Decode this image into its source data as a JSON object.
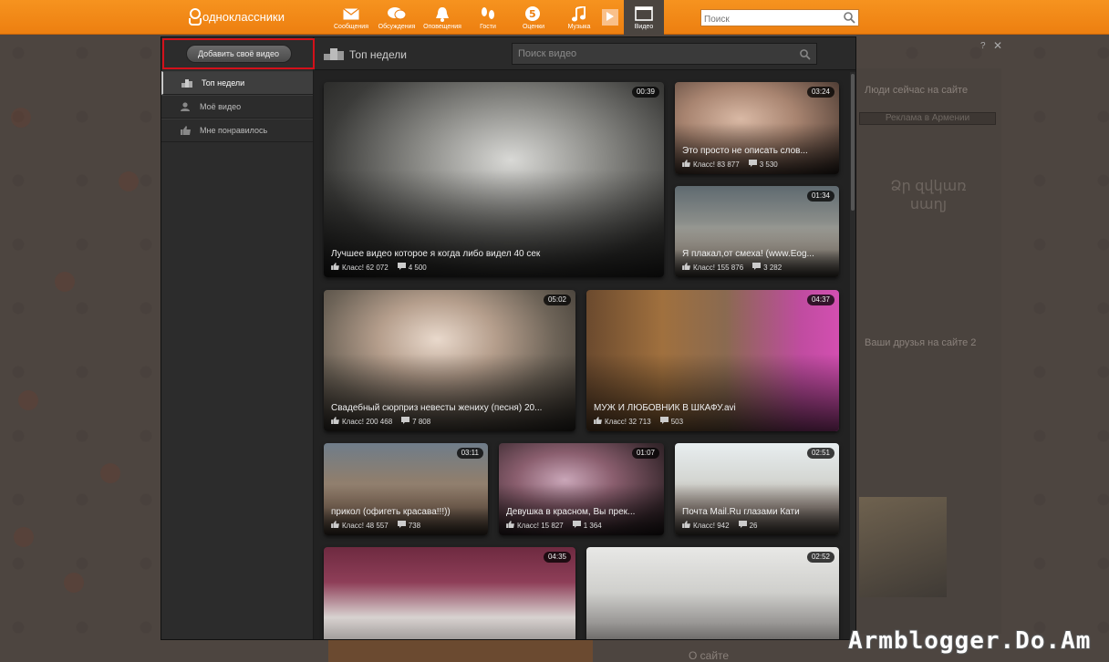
{
  "topbar": {
    "brand": "одноклассники",
    "nav": [
      {
        "label": "Сообщения",
        "icon": "envelope-icon"
      },
      {
        "label": "Обсуждения",
        "icon": "chat-bubbles-icon"
      },
      {
        "label": "Оповещения",
        "icon": "bell-icon"
      },
      {
        "label": "Гости",
        "icon": "footprints-icon"
      },
      {
        "label": "Оценки",
        "icon": "rating-5-icon"
      },
      {
        "label": "Музыка",
        "icon": "music-note-icon"
      },
      {
        "label": "Видео",
        "icon": "video-icon"
      }
    ],
    "search_placeholder": "Поиск"
  },
  "video": {
    "add_button": "Добавить своё видео",
    "menu": [
      {
        "label": "Топ недели",
        "icon": "podium-icon"
      },
      {
        "label": "Моё видео",
        "icon": "user-icon"
      },
      {
        "label": "Мне понравилось",
        "icon": "thumbs-up-icon"
      }
    ],
    "header_title": "Топ недели",
    "search_placeholder": "Поиск видео",
    "help": "?",
    "close": "✕",
    "cards": [
      {
        "title": "Лучшее видео которое я когда либо видел 40 сек",
        "duration": "00:39",
        "likes": "Класс! 62 072",
        "comments": "4 500"
      },
      {
        "title": "Это просто не описать слов...",
        "duration": "03:24",
        "likes": "Класс! 83 877",
        "comments": "3 530"
      },
      {
        "title": "Я плакал,от смеха! (www.Eog...",
        "duration": "01:34",
        "likes": "Класс! 155 876",
        "comments": "3 282"
      },
      {
        "title": "Свадебный сюрприз невесты жениху (песня) 20...",
        "duration": "05:02",
        "likes": "Класс! 200 468",
        "comments": "7 808"
      },
      {
        "title": "МУЖ И ЛЮБОВНИК В ШКАФУ.avi",
        "duration": "04:37",
        "likes": "Класс! 32 713",
        "comments": "503"
      },
      {
        "title": "прикол (офигеть красава!!!))",
        "duration": "03:11",
        "likes": "Класс! 48 557",
        "comments": "738"
      },
      {
        "title": "Девушка в красном, Вы прек...",
        "duration": "01:07",
        "likes": "Класс! 15 827",
        "comments": "1 364"
      },
      {
        "title": "Почта Mail.Ru глазами Кати",
        "duration": "02:51",
        "likes": "Класс! 942",
        "comments": "26"
      },
      {
        "title": "",
        "duration": "04:35",
        "likes": "",
        "comments": ""
      },
      {
        "title": "",
        "duration": "02:52",
        "likes": "",
        "comments": ""
      }
    ]
  },
  "background": {
    "people_online": "Люди сейчас на сайте",
    "ad_label": "Реклама в Армении",
    "friends_online": "Ваши друзья на сайте 2"
  },
  "watermark": "Armblogger.Do.Am",
  "colors": {
    "brand_orange": "#f08a16",
    "highlight_red": "#d3101a"
  }
}
